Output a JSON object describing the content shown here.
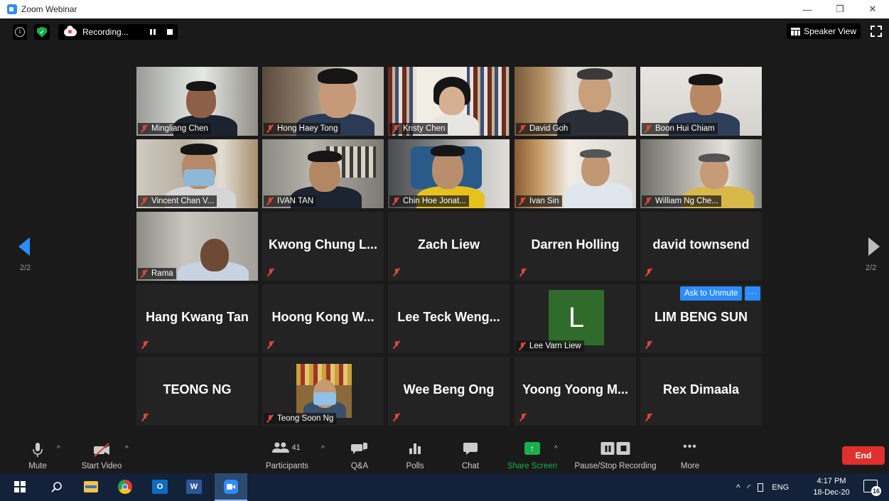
{
  "window": {
    "title": "Zoom Webinar",
    "controls": [
      "—",
      "❐",
      "✕"
    ]
  },
  "topbar": {
    "recording_label": "Recording...",
    "view_label": "Speaker View"
  },
  "paging": {
    "left": "2/2",
    "right": "2/2"
  },
  "colors": {
    "accent": "#2d8cff",
    "end": "#e0302c",
    "muted": "#e0463c",
    "share": "#18b04b"
  },
  "participants": [
    {
      "name": "Mingliang Chen",
      "video": true
    },
    {
      "name": "Hong Haey Tong",
      "video": true
    },
    {
      "name": "Kristy Chen",
      "video": true
    },
    {
      "name": "David Goh",
      "video": true
    },
    {
      "name": "Boon Hui Chiam",
      "video": true
    },
    {
      "name": "Vincent Chan V...",
      "video": true
    },
    {
      "name": "IVAN TAN",
      "video": true
    },
    {
      "name": "Chin Hoe Jonat...",
      "video": true
    },
    {
      "name": "Ivan Sin",
      "video": true
    },
    {
      "name": "William Ng Che...",
      "video": true
    },
    {
      "name": "Rama",
      "video": true
    },
    {
      "name": "Kwong Chung L...",
      "video": false
    },
    {
      "name": "Zach Liew",
      "video": false
    },
    {
      "name": "Darren Holling",
      "video": false
    },
    {
      "name": "david townsend",
      "video": false
    },
    {
      "name": "Hang Kwang Tan",
      "video": false
    },
    {
      "name": "Hoong Kong W...",
      "video": false
    },
    {
      "name": "Lee Teck Weng...",
      "video": false
    },
    {
      "name": "Lee Varn Liew",
      "video": false,
      "avatar_letter": "L"
    },
    {
      "name": "LIM BENG SUN",
      "video": false,
      "ask_unmute": "Ask to Unmute",
      "more": "···"
    },
    {
      "name": "TEONG NG",
      "video": false
    },
    {
      "name": "Teong Soon Ng",
      "video": false,
      "has_photo": true
    },
    {
      "name": "Wee Beng Ong",
      "video": false
    },
    {
      "name": "Yoong Yoong M...",
      "video": false
    },
    {
      "name": "Rex Dimaala",
      "video": false
    }
  ],
  "toolbar": {
    "mute": "Mute",
    "start_video": "Start Video",
    "participants": "Participants",
    "participant_count": "41",
    "qa": "Q&A",
    "polls": "Polls",
    "chat": "Chat",
    "share_screen": "Share Screen",
    "pause_stop_recording": "Pause/Stop Recording",
    "more": "More",
    "end": "End"
  },
  "taskbar": {
    "lang": "ENG",
    "time": "4:17 PM",
    "date": "18-Dec-20",
    "notifications": "16"
  }
}
